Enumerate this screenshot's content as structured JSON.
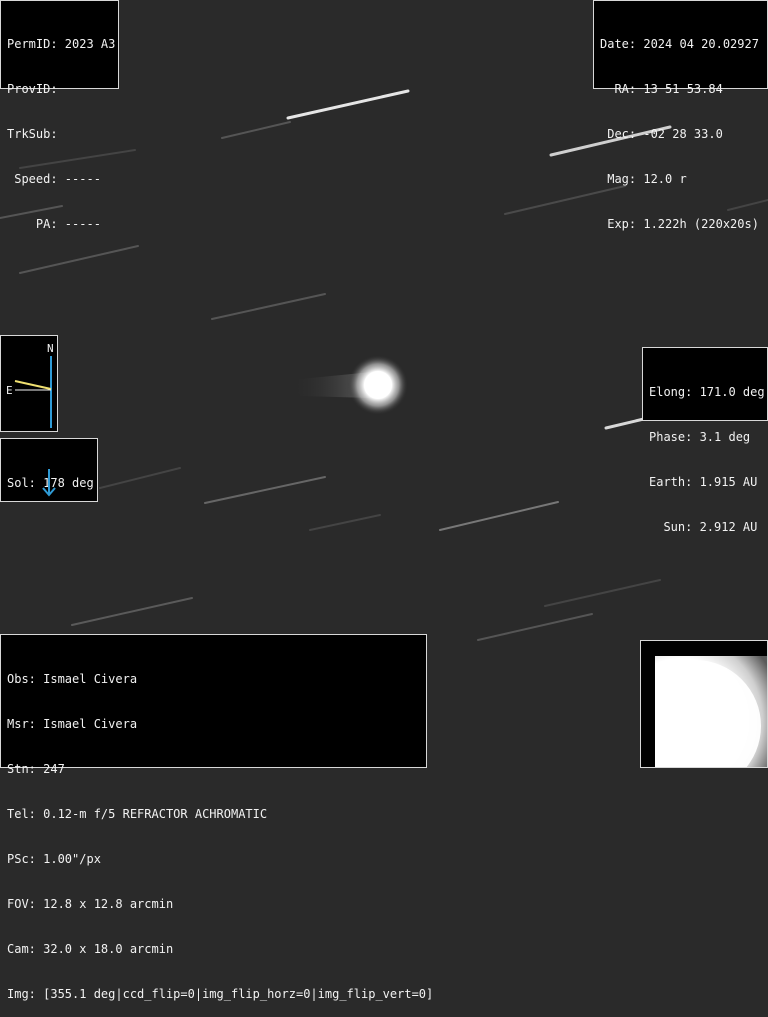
{
  "header_left": {
    "permid": "PermID: 2023 A3",
    "provid": "ProvID:",
    "trksub": "TrkSub:",
    "speed": " Speed: -----",
    "pa": "    PA: -----"
  },
  "header_right": {
    "date": "Date: 2024 04 20.02927",
    "ra": "  RA: 13 51 53.84",
    "dec": " Dec: -02 28 33.0",
    "mag": " Mag: 12.0 r",
    "exp": " Exp: 1.222h (220x20s)"
  },
  "compass": {
    "north": "N",
    "east": "E",
    "north_line_color": "#2f9bd6",
    "east_line_color": "#f0e070"
  },
  "sol": {
    "text": "Sol: 178 deg",
    "arrow_color": "#2f9bd6"
  },
  "geometry_info": {
    "elong": "Elong: 171.0 deg",
    "phase": "Phase: 3.1 deg",
    "earth": "Earth: 1.915 AU",
    "sun": "  Sun: 2.912 AU"
  },
  "observer_info": {
    "obs": "Obs: Ismael Civera",
    "msr": "Msr: Ismael Civera",
    "stn": "Stn: 247",
    "tel": "Tel: 0.12-m f/5 REFRACTOR ACHROMATIC",
    "psc": "PSc: 1.00\"/px",
    "fov": "FOV: 12.8 x 12.8 arcmin",
    "cam": "Cam: 32.0 x 18.0 arcmin",
    "img": "Img: [355.1 deg|ccd_flip=0|img_flip_horz=0|img_flip_vert=0]"
  },
  "colors": {
    "sky": "#2a2a2a",
    "panel_bg": "#000000",
    "panel_text": "#f2f2f2"
  }
}
